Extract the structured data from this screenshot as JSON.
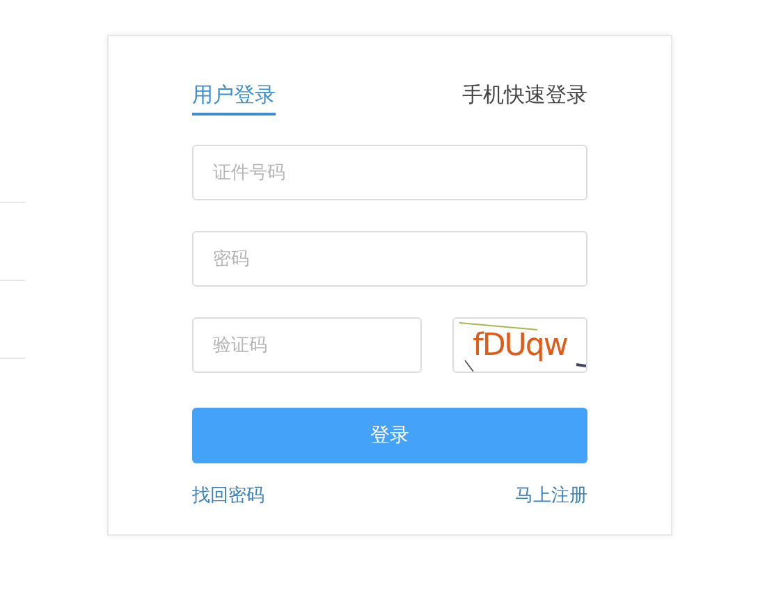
{
  "tabs": [
    {
      "label": "用户登录",
      "selected": true
    },
    {
      "label": "手机快速登录",
      "selected": false
    }
  ],
  "fields": [
    {
      "kind": "full",
      "placeholder": "证件号码"
    },
    {
      "kind": "full",
      "placeholder": "密码"
    },
    {
      "kind": "captcha",
      "placeholder": "验证码",
      "captcha": "fDUqw"
    }
  ],
  "submit": "登录",
  "links": [
    "找回密码",
    "马上注册"
  ]
}
